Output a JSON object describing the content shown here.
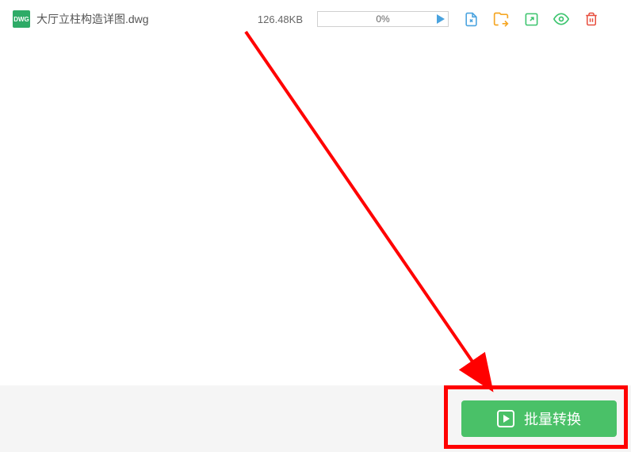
{
  "file": {
    "icon_label": "DWG",
    "name": "大厅立柱构造详图.dwg",
    "size": "126.48KB",
    "progress": "0%"
  },
  "bottom": {
    "batch_convert_label": "批量转换"
  },
  "colors": {
    "accent_green": "#4ac168",
    "icon_blue": "#4aa3df",
    "icon_orange": "#f5a623",
    "icon_green_export": "#3cc46e",
    "icon_eye": "#3cc46e",
    "icon_red": "#e74c3c",
    "dwg_bg": "#2eab67",
    "annotation_red": "#ff0000"
  }
}
